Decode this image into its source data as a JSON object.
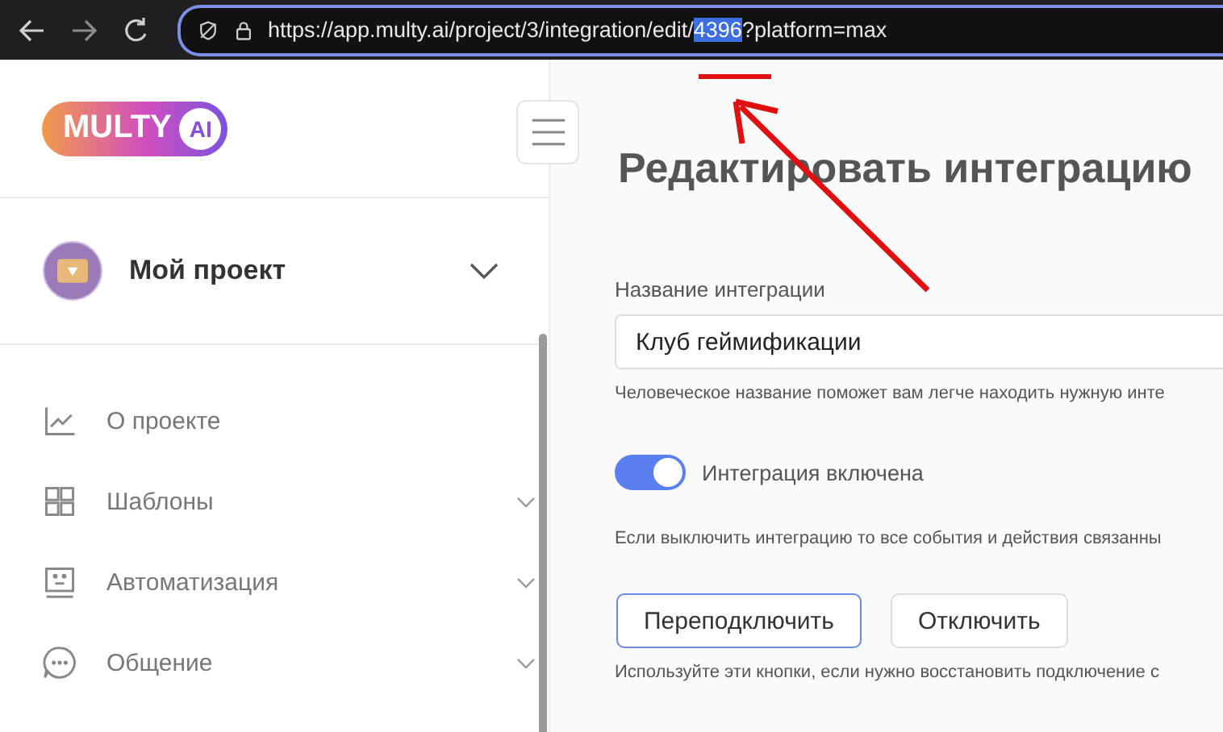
{
  "browser": {
    "url_before": "https://app.multy.ai/project/3/integration/edit/",
    "url_selected": "4396",
    "url_after": "?platform=max"
  },
  "sidebar": {
    "logo": {
      "word": "MULTY",
      "badge": "AI"
    },
    "project": {
      "name": "Мой проект",
      "expanded": false
    },
    "items": [
      {
        "kind": "chart",
        "label": "О проекте",
        "has_children": false
      },
      {
        "kind": "grid",
        "label": "Шаблоны",
        "has_children": true
      },
      {
        "kind": "bot",
        "label": "Автоматизация",
        "has_children": true
      },
      {
        "kind": "chat",
        "label": "Общение",
        "has_children": true
      }
    ]
  },
  "main": {
    "title": "Редактировать интеграцию",
    "name_field": {
      "label": "Название интеграции",
      "value": "Клуб геймификации",
      "hint": "Человеческое название поможет вам легче находить нужную инте"
    },
    "toggle": {
      "label": "Интеграция включена",
      "on": true,
      "hint": "Если выключить интеграцию то все события и действия связанны"
    },
    "buttons": [
      {
        "label": "Переподключить",
        "kind": "primary"
      },
      {
        "label": "Отключить",
        "kind": "secondary"
      }
    ],
    "buttons_hint": "Используйте эти кнопки, если нужно восстановить подключение с"
  },
  "annotation": {
    "kind": "arrow"
  }
}
